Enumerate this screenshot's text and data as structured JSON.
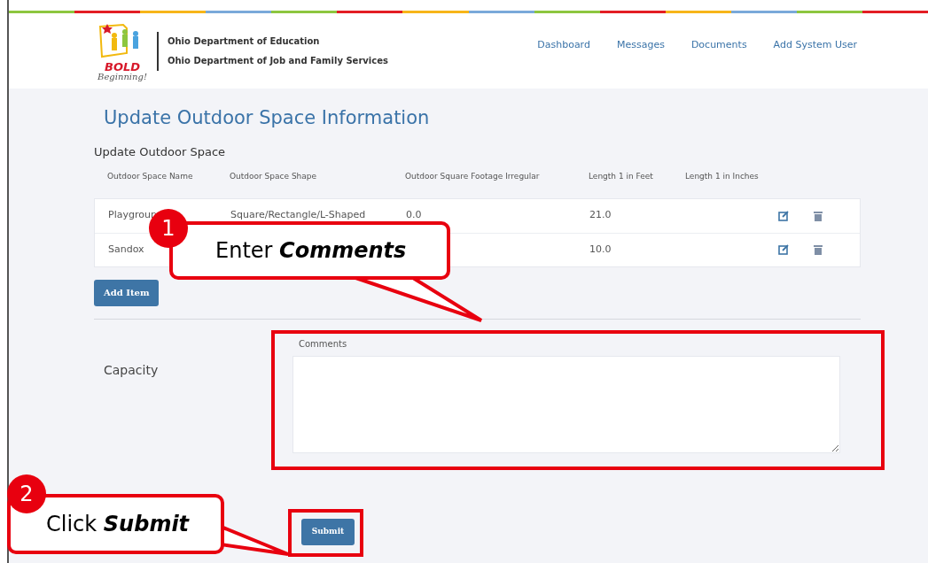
{
  "header": {
    "logo": {
      "word": "BOLD",
      "tagline": "Beginning!"
    },
    "org_lines": [
      "Ohio Department of Education",
      "Ohio Department of Job and Family Services"
    ],
    "nav": [
      "Dashboard",
      "Messages",
      "Documents",
      "Add System User"
    ]
  },
  "page_title": "Update Outdoor Space Information",
  "section_title": "Update Outdoor Space",
  "table": {
    "columns": [
      "Outdoor Space Name",
      "Outdoor Space Shape",
      "Outdoor Square Footage Irregular",
      "Length 1 in Feet",
      "Length 1 in Inches"
    ],
    "rows": [
      {
        "name": "Playgroun",
        "shape": "Square/Rectangle/L-Shaped",
        "footage": "0.0",
        "feet": "21.0"
      },
      {
        "name": "Sandox",
        "feet": "10.0"
      }
    ]
  },
  "add_button": "Add Item",
  "capacity": {
    "label": "Capacity",
    "comments_label": "Comments"
  },
  "submit_button": "Submit",
  "callouts": [
    {
      "number": "1",
      "text": "Enter **Comments**"
    },
    {
      "number": "2",
      "text": "Click **Submit**"
    }
  ]
}
